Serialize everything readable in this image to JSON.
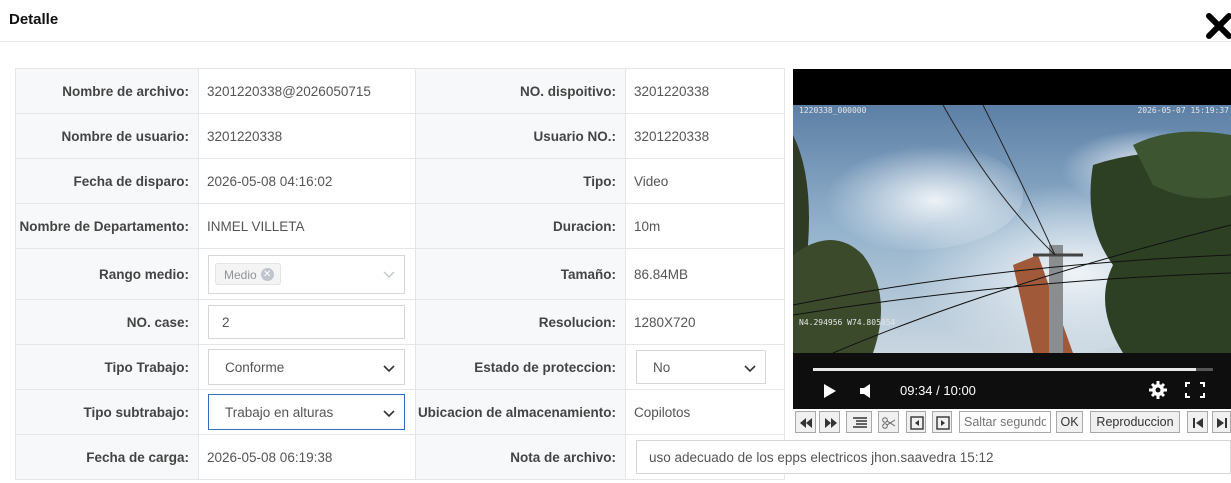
{
  "dialog": {
    "title": "Detalle"
  },
  "left": [
    {
      "label": "Nombre de archivo:",
      "value": "3201220338@2026050715"
    },
    {
      "label": "Nombre de usuario:",
      "value": "3201220338"
    },
    {
      "label": "Fecha de disparo:",
      "value": "2026-05-08 04:16:02"
    },
    {
      "label": "Nombre de Departamento:",
      "value": "INMEL VILLETA"
    },
    {
      "label": "Rango medio:",
      "tag": "Medio"
    },
    {
      "label": "NO. case:",
      "value": "2"
    },
    {
      "label": "Tipo Trabajo:",
      "value": "Conforme"
    },
    {
      "label": "Tipo subtrabajo:",
      "value": "Trabajo en alturas"
    },
    {
      "label": "Fecha de carga:",
      "value": "2026-05-08 06:19:38"
    }
  ],
  "right": [
    {
      "label": "NO. dispoitivo:",
      "value": "3201220338"
    },
    {
      "label": "Usuario NO.:",
      "value": "3201220338"
    },
    {
      "label": "Tipo:",
      "value": "Video"
    },
    {
      "label": "Duracion:",
      "value": "10m"
    },
    {
      "label": "Tamaño:",
      "value": "86.84MB"
    },
    {
      "label": "Resolucion:",
      "value": "1280X720"
    },
    {
      "label": "Estado de proteccion:",
      "value": "No"
    },
    {
      "label": "Ubicacion de almacenamiento:",
      "value": "Copilotos"
    },
    {
      "label": "Nota de archivo:",
      "value": "uso adecuado de los epps electricos jhon.saavedra 15:12"
    }
  ],
  "video": {
    "osd_top_left": "1220338_000000",
    "osd_top_right": "2026-05-07 15:19:37",
    "osd_gps": "N4.294956 W74.805054",
    "time": "09:34 / 10:00",
    "progress": 0.957
  },
  "toolbar": {
    "seek_placeholder": "Saltar segundos",
    "ok_label": "OK",
    "play_label": "Reproduccion"
  }
}
